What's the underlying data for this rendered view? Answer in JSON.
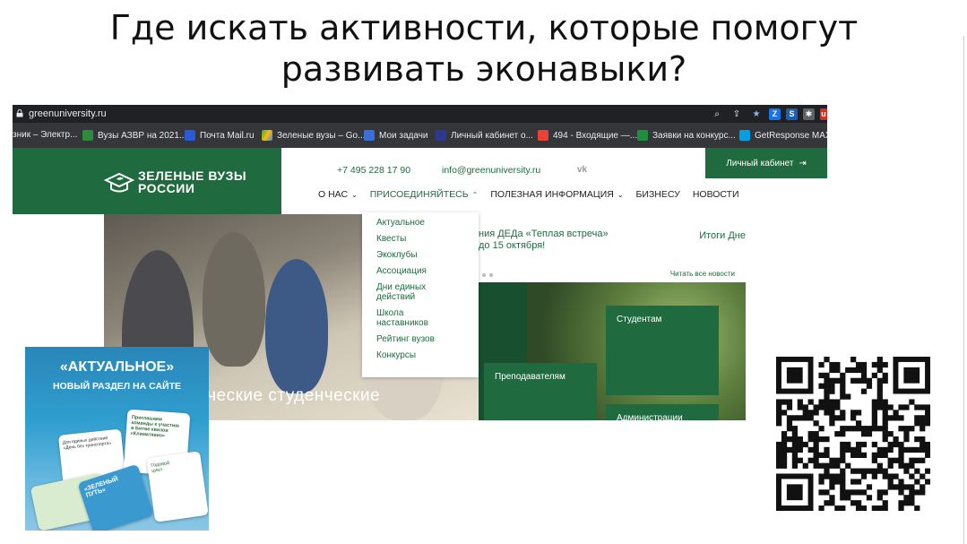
{
  "slide": {
    "title_line1": "Где искать активности, которые помогут",
    "title_line2": "развивать эконавыки?"
  },
  "browser": {
    "url": "greenuniversity.ru",
    "bookmarks": [
      "зник – Электр...",
      "Вузы АЗВР на 2021...",
      "Почта Mail.ru",
      "Зеленые вузы – Go...",
      "Мои задачи",
      "Личный кабинет о...",
      "494 - Входящие —...",
      "Заявки на конкурс...",
      "GetResponse MAX |"
    ]
  },
  "site": {
    "logo_line1": "ЗЕЛЕНЫЕ ВУЗЫ",
    "logo_line2": "РОССИИ",
    "phone": "+7 495 228 17 90",
    "email": "info@greenuniversity.ru",
    "vk": "vk",
    "cabinet": "Личный кабинет",
    "nav": [
      "О НАС",
      "ПРИСОЕДИНЯЙТЕСЬ",
      "ПОЛЕЗНАЯ ИНФОРМАЦИЯ",
      "БИЗНЕСУ",
      "НОВОСТИ"
    ],
    "dropdown": [
      "Актуальное",
      "Квесты",
      "Экоклубы",
      "Ассоциация",
      "Дни единых\nдействий",
      "Школа\nнаставников",
      "Рейтинг вузов",
      "Конкурсы"
    ],
    "news1_line1": "ния ДЕДа «Теплая встреча»",
    "news1_line2": "до 15 октября!",
    "news2": "Итоги Дне",
    "read_all": "Читать все новости",
    "hero_caption": "ические студенческие",
    "tiles": [
      "Студентам",
      "Преподавателям",
      "Администрации"
    ]
  },
  "promo": {
    "title": "«АКТУАЛЬНОЕ»",
    "subtitle": "НОВЫЙ РАЗДЕЛ НА САЙТЕ",
    "card1": "Для единых действий\n«День без транспорта»",
    "card2": "Приглашаем\nкоманды к участию\nв Битве квизов\n«Климатквиз»",
    "card3": "«ЗЕЛЕНЫЙ ПУТЬ»",
    "card4": "Годовой\nцикл"
  },
  "qr": {
    "label": "qr-code"
  }
}
